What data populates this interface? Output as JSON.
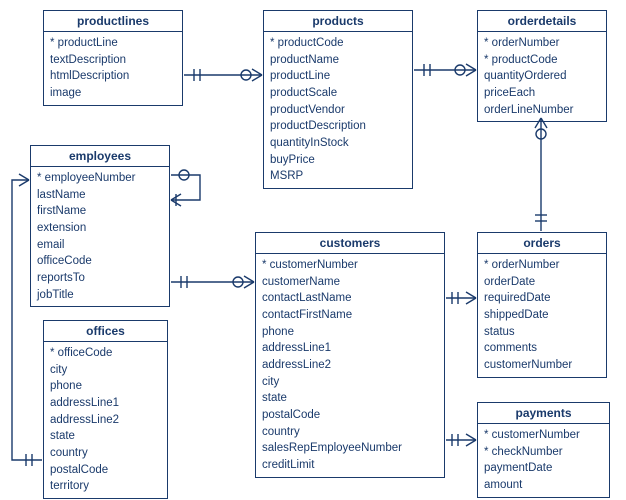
{
  "entities": {
    "productlines": {
      "title": "productlines",
      "fields": [
        {
          "text": "* productLine",
          "pk": true
        },
        {
          "text": "textDescription"
        },
        {
          "text": "htmlDescription"
        },
        {
          "text": "image"
        }
      ]
    },
    "products": {
      "title": "products",
      "fields": [
        {
          "text": "* productCode",
          "pk": true
        },
        {
          "text": "productName"
        },
        {
          "text": "productLine"
        },
        {
          "text": "productScale"
        },
        {
          "text": "productVendor"
        },
        {
          "text": "productDescription"
        },
        {
          "text": "quantityInStock"
        },
        {
          "text": "buyPrice"
        },
        {
          "text": "MSRP"
        }
      ]
    },
    "orderdetails": {
      "title": "orderdetails",
      "fields": [
        {
          "text": "* orderNumber",
          "pk": true
        },
        {
          "text": "* productCode",
          "pk": true
        },
        {
          "text": "quantityOrdered"
        },
        {
          "text": "priceEach"
        },
        {
          "text": "orderLineNumber"
        }
      ]
    },
    "employees": {
      "title": "employees",
      "fields": [
        {
          "text": "* employeeNumber",
          "pk": true
        },
        {
          "text": "lastName"
        },
        {
          "text": "firstName"
        },
        {
          "text": "extension"
        },
        {
          "text": "email"
        },
        {
          "text": "officeCode"
        },
        {
          "text": "reportsTo"
        },
        {
          "text": "jobTitle"
        }
      ]
    },
    "customers": {
      "title": "customers",
      "fields": [
        {
          "text": "* customerNumber",
          "pk": true
        },
        {
          "text": "customerName"
        },
        {
          "text": "contactLastName"
        },
        {
          "text": "contactFirstName"
        },
        {
          "text": "phone"
        },
        {
          "text": "addressLine1"
        },
        {
          "text": "addressLine2"
        },
        {
          "text": "city"
        },
        {
          "text": "state"
        },
        {
          "text": "postalCode"
        },
        {
          "text": "country"
        },
        {
          "text": "salesRepEmployeeNumber"
        },
        {
          "text": "creditLimit"
        }
      ]
    },
    "orders": {
      "title": "orders",
      "fields": [
        {
          "text": "* orderNumber",
          "pk": true
        },
        {
          "text": "orderDate"
        },
        {
          "text": "requiredDate"
        },
        {
          "text": "shippedDate"
        },
        {
          "text": "status"
        },
        {
          "text": "comments"
        },
        {
          "text": "customerNumber"
        }
      ]
    },
    "offices": {
      "title": "offices",
      "fields": [
        {
          "text": "* officeCode",
          "pk": true
        },
        {
          "text": "city"
        },
        {
          "text": "phone"
        },
        {
          "text": "addressLine1"
        },
        {
          "text": "addressLine2"
        },
        {
          "text": "state"
        },
        {
          "text": "country"
        },
        {
          "text": "postalCode"
        },
        {
          "text": "territory"
        }
      ]
    },
    "payments": {
      "title": "payments",
      "fields": [
        {
          "text": "* customerNumber",
          "pk": true
        },
        {
          "text": "* checkNumber",
          "pk": true
        },
        {
          "text": "paymentDate"
        },
        {
          "text": "amount"
        }
      ]
    }
  },
  "relationships": [
    {
      "from": "productlines",
      "to": "products",
      "type": "one-to-many"
    },
    {
      "from": "products",
      "to": "orderdetails",
      "type": "one-to-many"
    },
    {
      "from": "orders",
      "to": "orderdetails",
      "type": "one-to-many"
    },
    {
      "from": "customers",
      "to": "orders",
      "type": "one-to-many"
    },
    {
      "from": "customers",
      "to": "payments",
      "type": "one-to-many"
    },
    {
      "from": "employees",
      "to": "customers",
      "type": "one-to-many"
    },
    {
      "from": "employees",
      "to": "employees",
      "type": "one-to-many",
      "note": "self-reference reportsTo"
    },
    {
      "from": "offices",
      "to": "employees",
      "type": "one-to-many"
    }
  ]
}
